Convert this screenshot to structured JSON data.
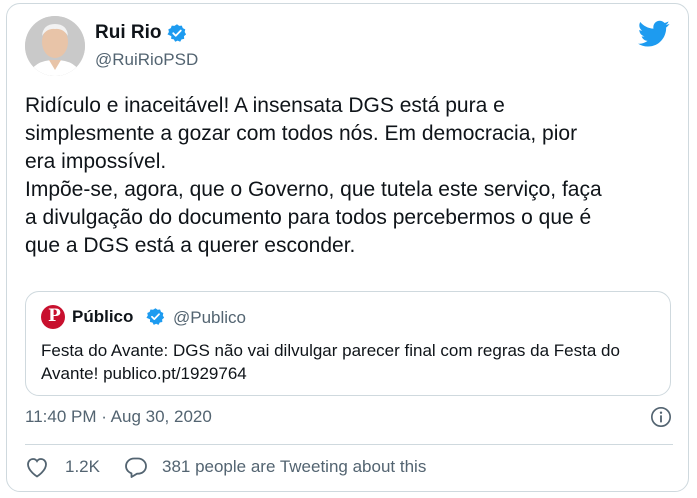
{
  "tweet": {
    "display_name": "Rui Rio",
    "handle": "@RuiRioPSD",
    "text": "Ridículo e inaceitável! A insensata DGS está pura e\nsimplesmente a gozar com todos nós. Em democracia, pior\nera impossível.\nImpõe-se, agora, que o Governo, que tutela este serviço, faça\na divulgação do documento para todos percebermos o que é\nque a DGS está a querer esconder.",
    "timestamp": "11:40 PM · Aug 30, 2020",
    "likes": "1.2K",
    "talking": "381 people are Tweeting about this"
  },
  "quoted": {
    "logo_letter": "P",
    "name": "Público",
    "handle": "@Publico",
    "text": "Festa do Avante: DGS não vai dilvulgar parecer final com regras da Festa do Avante! publico.pt/1929764"
  },
  "colors": {
    "twitter_blue": "#1d9bf0",
    "secondary_text": "#536471",
    "border": "#cfd9de",
    "publico_red": "#c8102e"
  },
  "icons": [
    "verified-badge-icon",
    "twitter-bird-icon",
    "info-icon",
    "heart-icon",
    "speech-bubble-icon"
  ]
}
